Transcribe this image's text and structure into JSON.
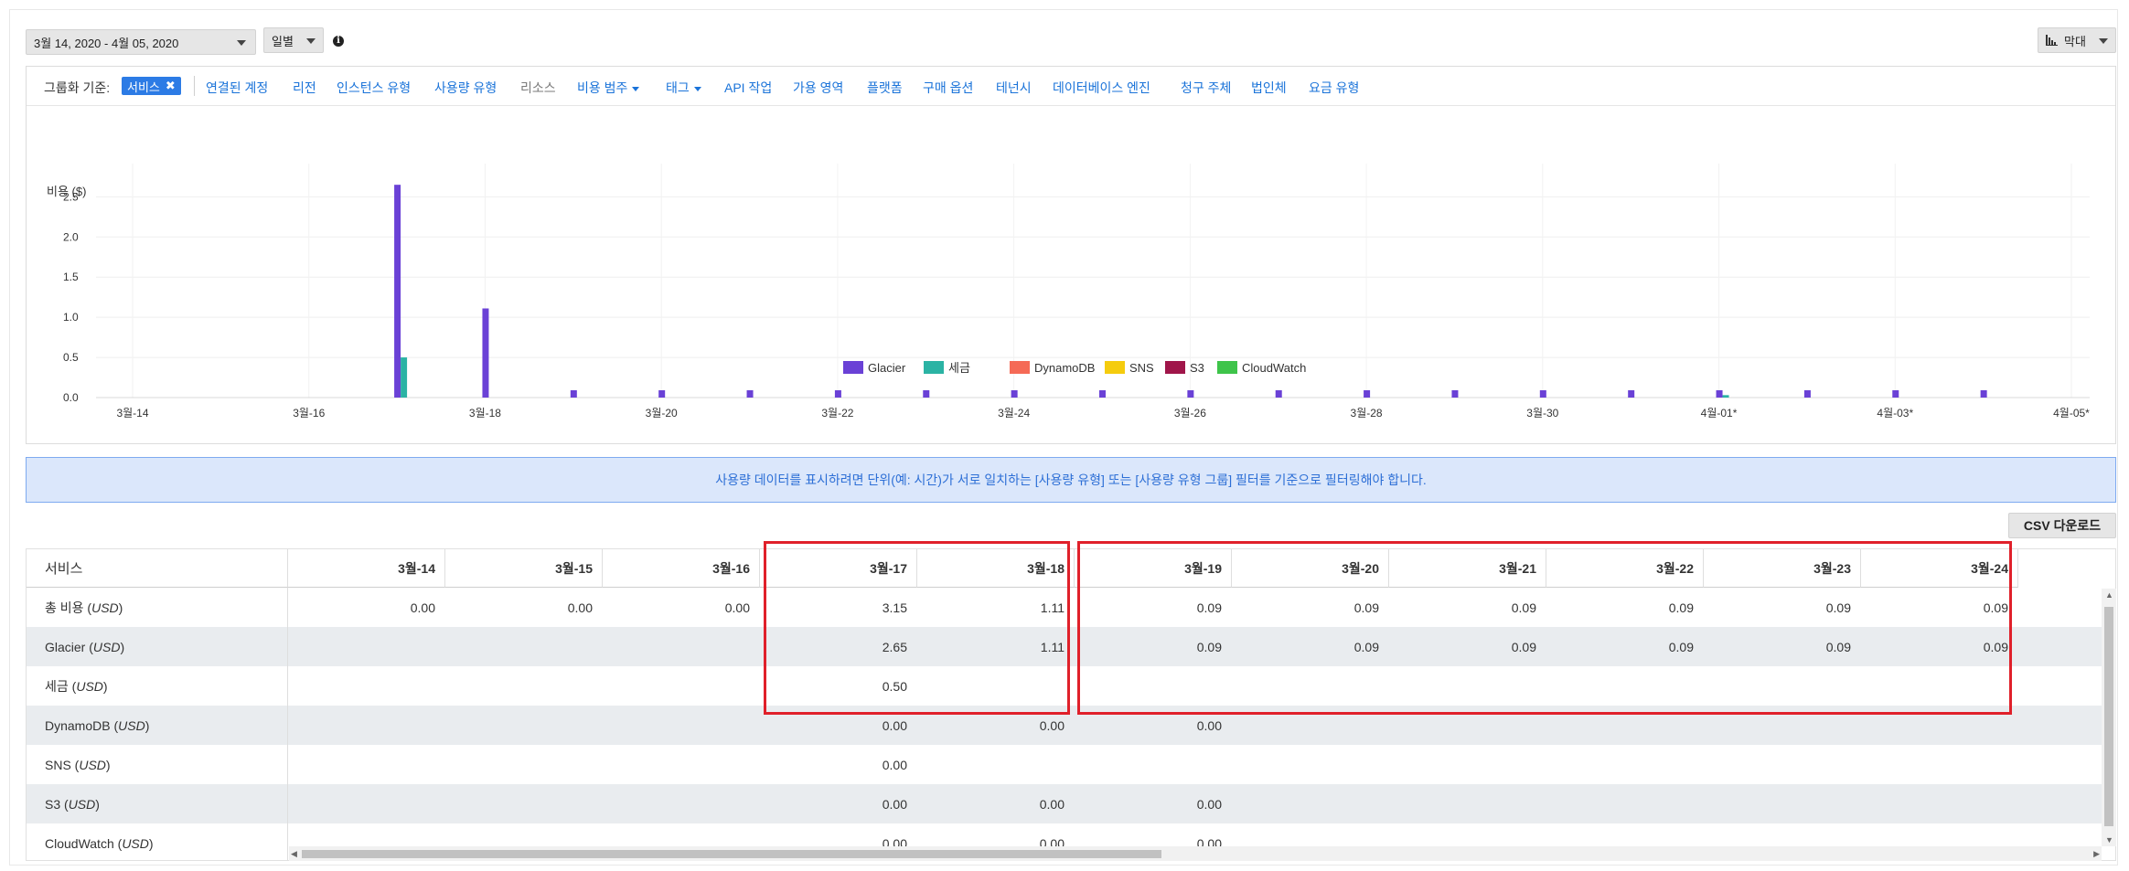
{
  "toolbar": {
    "date_range": "3월 14, 2020 - 4월 05, 2020",
    "granularity": "일별",
    "chart_type": "막대",
    "csv_label": "CSV 다운로드"
  },
  "groupbar": {
    "label": "그룹화 기준:",
    "selected": "서비스",
    "items": [
      "연결된 계정",
      "리전",
      "인스턴스 유형",
      "사용량 유형",
      "리소스",
      "비용 범주",
      "태그",
      "API 작업",
      "가용 영역",
      "플랫폼",
      "구매 옵션",
      "테넌시",
      "데이터베이스 엔진",
      "청구 주체",
      "법인체",
      "요금 유형"
    ]
  },
  "notice": "사용량 데이터를 표시하려면 단위(예: 시간)가 서로 일치하는 [사용량 유형] 또는 [사용량 유형 그룹] 필터를 기준으로 필터링해야 합니다.",
  "chart_data": {
    "type": "bar",
    "ylabel": "비용 ($)",
    "ylim": [
      0,
      2.8
    ],
    "yticks": [
      "0.0",
      "0.5",
      "1.0",
      "1.5",
      "2.0",
      "2.5"
    ],
    "x": [
      "3월-14",
      "3월-15",
      "3월-16",
      "3월-17",
      "3월-18",
      "3월-19",
      "3월-20",
      "3월-21",
      "3월-22",
      "3월-23",
      "3월-24",
      "3월-25",
      "3월-26",
      "3월-27",
      "3월-28",
      "3월-29",
      "3월-30",
      "3월-31",
      "4월-01",
      "4월-02",
      "4월-03",
      "4월-04",
      "4월-05"
    ],
    "xtick_labels": [
      "3월-14",
      "3월-16",
      "3월-18",
      "3월-20",
      "3월-22",
      "3월-24",
      "3월-26",
      "3월-28",
      "3월-30",
      "4월-01*",
      "4월-03*",
      "4월-05*"
    ],
    "series": [
      {
        "name": "Glacier",
        "color": "#6a41d6",
        "values": [
          0,
          0,
          0,
          2.65,
          1.11,
          0.09,
          0.09,
          0.09,
          0.09,
          0.09,
          0.09,
          0.09,
          0.09,
          0.09,
          0.09,
          0.09,
          0.09,
          0.09,
          0.09,
          0.09,
          0.09,
          0.09,
          0
        ]
      },
      {
        "name": "세금",
        "color": "#2bb3a4",
        "values": [
          0,
          0,
          0,
          0.5,
          0,
          0,
          0,
          0,
          0,
          0,
          0,
          0,
          0,
          0,
          0,
          0,
          0,
          0,
          0.03,
          0,
          0,
          0,
          0
        ]
      },
      {
        "name": "DynamoDB",
        "color": "#f56a56",
        "values": [
          0,
          0,
          0,
          0,
          0,
          0,
          0,
          0,
          0,
          0,
          0,
          0,
          0,
          0,
          0,
          0,
          0,
          0,
          0,
          0,
          0,
          0,
          0
        ]
      },
      {
        "name": "SNS",
        "color": "#f5cc0e",
        "values": [
          0,
          0,
          0,
          0,
          0,
          0,
          0,
          0,
          0,
          0,
          0,
          0,
          0,
          0,
          0,
          0,
          0,
          0,
          0,
          0,
          0,
          0,
          0
        ]
      },
      {
        "name": "S3",
        "color": "#a0164a",
        "values": [
          0,
          0,
          0,
          0,
          0,
          0,
          0,
          0,
          0,
          0,
          0,
          0,
          0,
          0,
          0,
          0,
          0,
          0,
          0,
          0,
          0,
          0,
          0
        ]
      },
      {
        "name": "CloudWatch",
        "color": "#3ec44a",
        "values": [
          0,
          0,
          0,
          0,
          0,
          0,
          0,
          0,
          0,
          0,
          0,
          0,
          0,
          0,
          0,
          0,
          0,
          0,
          0,
          0,
          0,
          0,
          0
        ]
      }
    ],
    "legend_position": "bottom"
  },
  "table": {
    "first_header": "서비스",
    "columns": [
      "3월-14",
      "3월-15",
      "3월-16",
      "3월-17",
      "3월-18",
      "3월-19",
      "3월-20",
      "3월-21",
      "3월-22",
      "3월-23",
      "3월-24"
    ],
    "rows": [
      {
        "label": "총 비용",
        "unit": "USD",
        "values": [
          "0.00",
          "0.00",
          "0.00",
          "3.15",
          "1.11",
          "0.09",
          "0.09",
          "0.09",
          "0.09",
          "0.09",
          "0.09"
        ]
      },
      {
        "label": "Glacier",
        "unit": "USD",
        "values": [
          "",
          "",
          "",
          "2.65",
          "1.11",
          "0.09",
          "0.09",
          "0.09",
          "0.09",
          "0.09",
          "0.09"
        ]
      },
      {
        "label": "세금",
        "unit": "USD",
        "values": [
          "",
          "",
          "",
          "0.50",
          "",
          "",
          "",
          "",
          "",
          "",
          ""
        ]
      },
      {
        "label": "DynamoDB",
        "unit": "USD",
        "values": [
          "",
          "",
          "",
          "0.00",
          "0.00",
          "0.00",
          "",
          "",
          "",
          "",
          ""
        ]
      },
      {
        "label": "SNS",
        "unit": "USD",
        "values": [
          "",
          "",
          "",
          "0.00",
          "",
          "",
          "",
          "",
          "",
          "",
          ""
        ]
      },
      {
        "label": "S3",
        "unit": "USD",
        "values": [
          "",
          "",
          "",
          "0.00",
          "0.00",
          "0.00",
          "",
          "",
          "",
          "",
          ""
        ]
      },
      {
        "label": "CloudWatch",
        "unit": "USD",
        "values": [
          "",
          "",
          "",
          "0.00",
          "0.00",
          "0.00",
          "",
          "",
          "",
          "",
          ""
        ]
      }
    ]
  }
}
